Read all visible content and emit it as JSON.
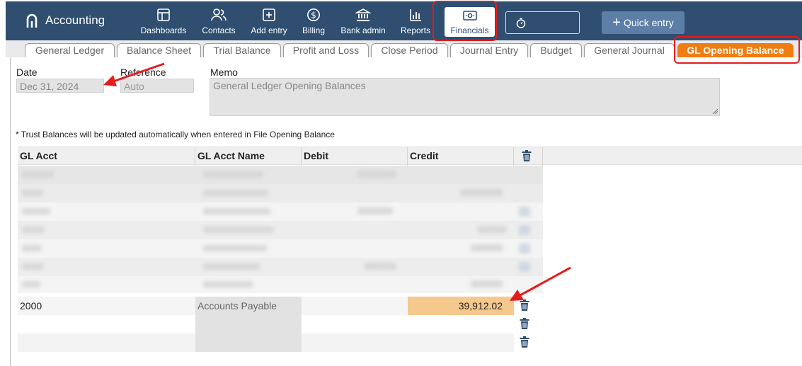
{
  "app": {
    "title": "Accounting"
  },
  "nav": {
    "dashboards": "Dashboards",
    "contacts": "Contacts",
    "add_entry": "Add entry",
    "billing": "Billing",
    "bank_admin": "Bank admin",
    "reports": "Reports",
    "financials": "Financials"
  },
  "quick_entry": "Quick entry",
  "tabs": {
    "general_ledger": "General Ledger",
    "balance_sheet": "Balance Sheet",
    "trial_balance": "Trial Balance",
    "profit_and_loss": "Profit and Loss",
    "close_period": "Close Period",
    "journal_entry": "Journal Entry",
    "budget": "Budget",
    "general_journal": "General Journal",
    "gl_opening_balance": "GL Opening Balance"
  },
  "form": {
    "date_label": "Date",
    "date_value": "Dec 31, 2024",
    "reference_label": "Reference",
    "reference_placeholder": "Auto",
    "memo_label": "Memo",
    "memo_value": "General Ledger Opening Balances"
  },
  "note": "* Trust Balances will be updated automatically when entered in File Opening Balance",
  "grid": {
    "headers": {
      "gl_acct": "GL Acct",
      "gl_acct_name": "GL Acct Name",
      "debit": "Debit",
      "credit": "Credit"
    },
    "rows": [
      {
        "gl_acct": "2000",
        "gl_acct_name": "Accounts Payable",
        "debit": "",
        "credit": "39,912.02"
      }
    ]
  },
  "colors": {
    "topbar": "#2f4e70",
    "active_tab": "#ef7d12",
    "highlight_cell": "#f5c88e",
    "annotation": "#e31c1c"
  }
}
